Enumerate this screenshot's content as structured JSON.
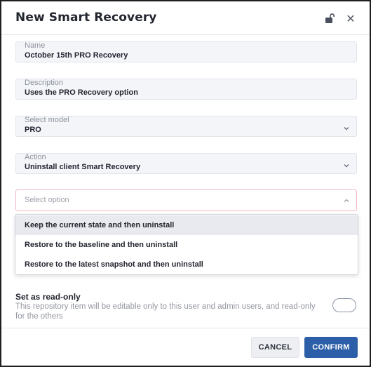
{
  "dialog": {
    "title": "New Smart Recovery",
    "lock_icon": "unlocked-padlock-icon",
    "close_icon": "close-icon",
    "close_glyph": "✕"
  },
  "fields": {
    "name": {
      "label": "Name",
      "value": "October 15th PRO Recovery"
    },
    "description": {
      "label": "Description",
      "value": "Uses the PRO Recovery option"
    },
    "model": {
      "label": "Select model",
      "value": "PRO"
    },
    "action": {
      "label": "Action",
      "value": "Uninstall client Smart Recovery"
    }
  },
  "option_select": {
    "placeholder": "Select option",
    "options": [
      "Keep the current state and then uninstall",
      "Restore to the baseline and then uninstall",
      "Restore to the latest snapshot and then uninstall"
    ],
    "highlighted_index": 0
  },
  "read_only": {
    "title": "Set as read-only",
    "description": "This repository item will be editable only to this user and admin users, and read-only for the others",
    "enabled": false
  },
  "footer": {
    "cancel_label": "CANCEL",
    "confirm_label": "CONFIRM"
  },
  "colors": {
    "primary": "#2d5fa8",
    "field_bg": "#f3f5f9",
    "error_border": "#f0b8c0"
  }
}
